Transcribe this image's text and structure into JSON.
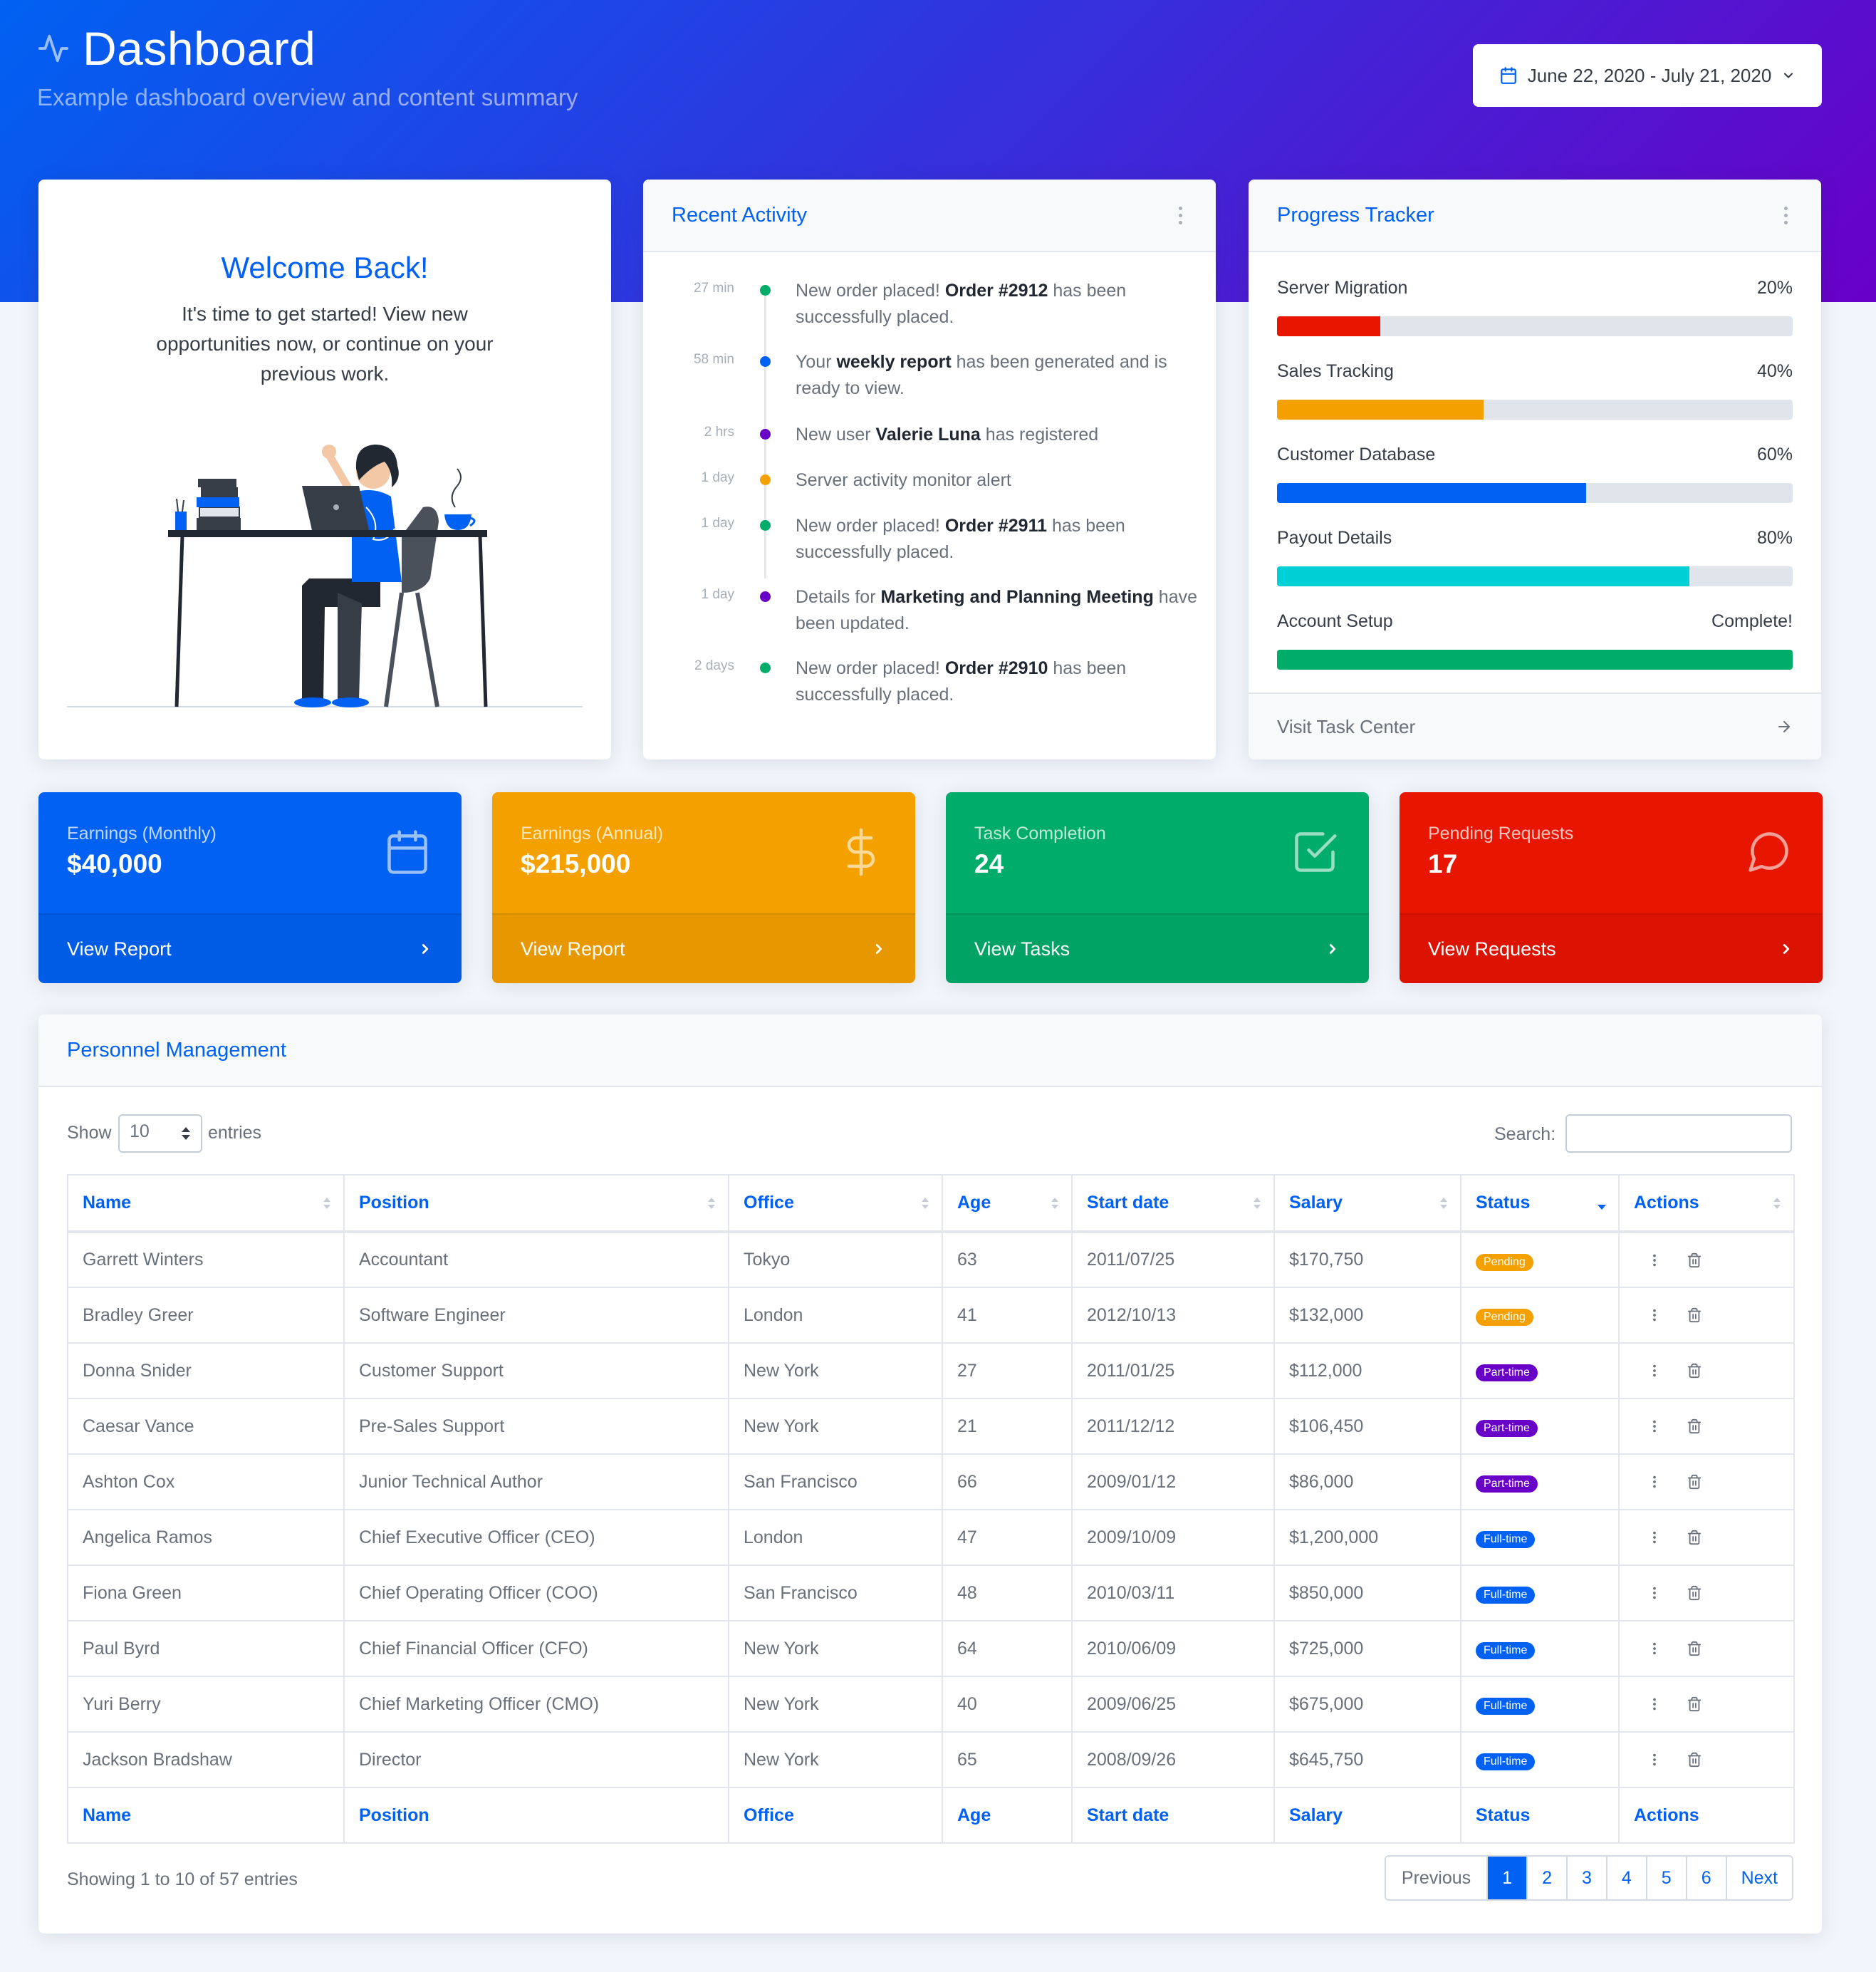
{
  "header": {
    "title": "Dashboard",
    "subtitle": "Example dashboard overview and content summary",
    "date_range": "June 22, 2020 - July 21, 2020"
  },
  "welcome": {
    "title": "Welcome Back!",
    "text": "It's time to get started! View new opportunities now, or continue on your previous work."
  },
  "activity": {
    "title": "Recent Activity",
    "items": [
      {
        "time": "27 min",
        "color": "#00ac69",
        "pre": "New order placed! ",
        "bold": "Order #2912",
        "post": " has been successfully placed."
      },
      {
        "time": "58 min",
        "color": "#0061f2",
        "pre": "Your ",
        "bold": "weekly report",
        "post": " has been generated and is ready to view."
      },
      {
        "time": "2 hrs",
        "color": "#6900c7",
        "pre": "New user ",
        "bold": "Valerie Luna",
        "post": " has registered"
      },
      {
        "time": "1 day",
        "color": "#f4a100",
        "pre": "Server activity monitor alert",
        "bold": "",
        "post": ""
      },
      {
        "time": "1 day",
        "color": "#00ac69",
        "pre": "New order placed! ",
        "bold": "Order #2911",
        "post": " has been successfully placed."
      },
      {
        "time": "1 day",
        "color": "#6900c7",
        "pre": "Details for ",
        "bold": "Marketing and Planning Meeting",
        "post": " have been updated."
      },
      {
        "time": "2 days",
        "color": "#00ac69",
        "pre": "New order placed! ",
        "bold": "Order #2910",
        "post": " has been successfully placed."
      }
    ]
  },
  "progress": {
    "title": "Progress Tracker",
    "footer": "Visit Task Center",
    "items": [
      {
        "label": "Server Migration",
        "value": "20%",
        "fraction": 0.2,
        "color": "#e81500"
      },
      {
        "label": "Sales Tracking",
        "value": "40%",
        "fraction": 0.4,
        "color": "#f4a100"
      },
      {
        "label": "Customer Database",
        "value": "60%",
        "fraction": 0.6,
        "color": "#0061f2"
      },
      {
        "label": "Payout Details",
        "value": "80%",
        "fraction": 0.8,
        "color": "#00cfd5"
      },
      {
        "label": "Account Setup",
        "value": "Complete!",
        "fraction": 1.0,
        "color": "#00ac69"
      }
    ]
  },
  "stats": [
    {
      "label": "Earnings (Monthly)",
      "value": "$40,000",
      "link": "View Report",
      "color": "#0061f2",
      "icon": "calendar-icon"
    },
    {
      "label": "Earnings (Annual)",
      "value": "$215,000",
      "link": "View Report",
      "color": "#f4a100",
      "icon": "dollar-icon"
    },
    {
      "label": "Task Completion",
      "value": "24",
      "link": "View Tasks",
      "color": "#00ac69",
      "icon": "check-square-icon"
    },
    {
      "label": "Pending Requests",
      "value": "17",
      "link": "View Requests",
      "color": "#e81500",
      "icon": "message-icon"
    }
  ],
  "personnel": {
    "title": "Personnel Management",
    "show_label": "Show",
    "entries_value": "10",
    "entries_label": "entries",
    "search_label": "Search:",
    "columns": [
      "Name",
      "Position",
      "Office",
      "Age",
      "Start date",
      "Salary",
      "Status",
      "Actions"
    ],
    "rows": [
      {
        "name": "Garrett Winters",
        "position": "Accountant",
        "office": "Tokyo",
        "age": "63",
        "start": "2011/07/25",
        "salary": "$170,750",
        "status": "Pending",
        "status_color": "#f4a100"
      },
      {
        "name": "Bradley Greer",
        "position": "Software Engineer",
        "office": "London",
        "age": "41",
        "start": "2012/10/13",
        "salary": "$132,000",
        "status": "Pending",
        "status_color": "#f4a100"
      },
      {
        "name": "Donna Snider",
        "position": "Customer Support",
        "office": "New York",
        "age": "27",
        "start": "2011/01/25",
        "salary": "$112,000",
        "status": "Part-time",
        "status_color": "#6900c7"
      },
      {
        "name": "Caesar Vance",
        "position": "Pre-Sales Support",
        "office": "New York",
        "age": "21",
        "start": "2011/12/12",
        "salary": "$106,450",
        "status": "Part-time",
        "status_color": "#6900c7"
      },
      {
        "name": "Ashton Cox",
        "position": "Junior Technical Author",
        "office": "San Francisco",
        "age": "66",
        "start": "2009/01/12",
        "salary": "$86,000",
        "status": "Part-time",
        "status_color": "#6900c7"
      },
      {
        "name": "Angelica Ramos",
        "position": "Chief Executive Officer (CEO)",
        "office": "London",
        "age": "47",
        "start": "2009/10/09",
        "salary": "$1,200,000",
        "status": "Full-time",
        "status_color": "#0061f2"
      },
      {
        "name": "Fiona Green",
        "position": "Chief Operating Officer (COO)",
        "office": "San Francisco",
        "age": "48",
        "start": "2010/03/11",
        "salary": "$850,000",
        "status": "Full-time",
        "status_color": "#0061f2"
      },
      {
        "name": "Paul Byrd",
        "position": "Chief Financial Officer (CFO)",
        "office": "New York",
        "age": "64",
        "start": "2010/06/09",
        "salary": "$725,000",
        "status": "Full-time",
        "status_color": "#0061f2"
      },
      {
        "name": "Yuri Berry",
        "position": "Chief Marketing Officer (CMO)",
        "office": "New York",
        "age": "40",
        "start": "2009/06/25",
        "salary": "$675,000",
        "status": "Full-time",
        "status_color": "#0061f2"
      },
      {
        "name": "Jackson Bradshaw",
        "position": "Director",
        "office": "New York",
        "age": "65",
        "start": "2008/09/26",
        "salary": "$645,750",
        "status": "Full-time",
        "status_color": "#0061f2"
      }
    ],
    "info": "Showing 1 to 10 of 57 entries",
    "pagination": {
      "previous": "Previous",
      "pages": [
        "1",
        "2",
        "3",
        "4",
        "5",
        "6"
      ],
      "active": "1",
      "next": "Next"
    }
  }
}
